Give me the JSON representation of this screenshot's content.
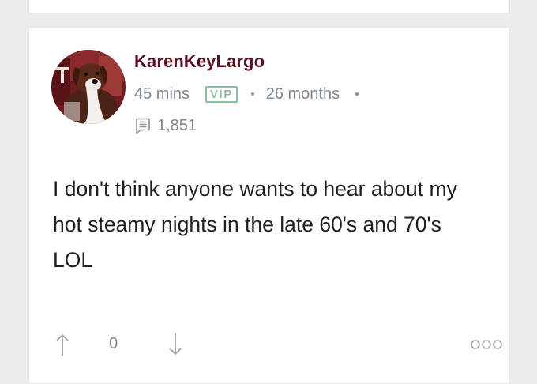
{
  "post": {
    "author": {
      "username": "KarenKeyLargo",
      "avatar_icon": "dog-photo-avatar",
      "badge": "VIP",
      "member_duration": "26 months",
      "post_count": "1,851"
    },
    "timestamp": "45 mins",
    "body": "I don't think anyone wants to hear about my hot steamy nights in the late 60's and 70's LOL",
    "votes": "0"
  },
  "icons": {
    "posts": "posts-count-icon",
    "upvote": "arrow-up-icon",
    "downvote": "arrow-down-icon",
    "more": "more-options-icon"
  },
  "colors": {
    "username": "#5c0f1e",
    "meta": "#7e8790",
    "vip_badge": "#8bbd9f",
    "icon": "#9aa1a8",
    "body_text": "#1f1f1f",
    "background": "#ececec"
  }
}
